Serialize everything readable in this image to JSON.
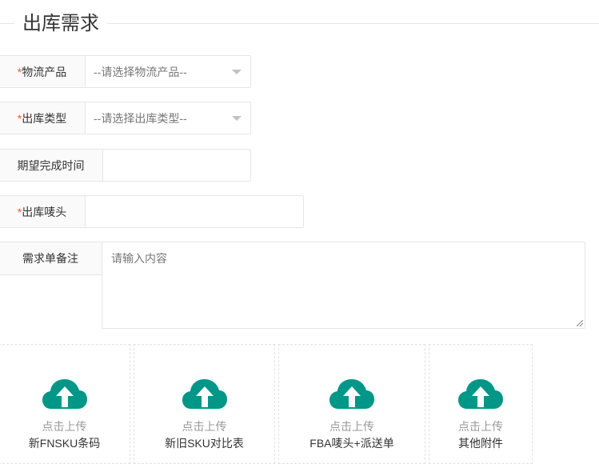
{
  "section": {
    "title": "出库需求"
  },
  "form": {
    "logistics_product": {
      "required_mark": "*",
      "label": "物流产品",
      "placeholder": "--请选择物流产品--"
    },
    "outbound_type": {
      "required_mark": "*",
      "label": "出库类型",
      "placeholder": "--请选择出库类型--"
    },
    "expected_time": {
      "label": "期望完成时间",
      "value": ""
    },
    "outbound_mark": {
      "required_mark": "*",
      "label": "出库唛头",
      "value": ""
    },
    "remark": {
      "label": "需求单备注",
      "placeholder": "请输入内容"
    }
  },
  "uploads": [
    {
      "hint": "点击上传",
      "name": "新FNSKU条码"
    },
    {
      "hint": "点击上传",
      "name": "新旧SKU对比表"
    },
    {
      "hint": "点击上传",
      "name": "FBA唛头+派送单"
    },
    {
      "hint": "点击上传",
      "name": "其他附件"
    }
  ],
  "colors": {
    "upload_icon": "#009688",
    "required": "#ff5722",
    "border": "#e6e6e6"
  }
}
